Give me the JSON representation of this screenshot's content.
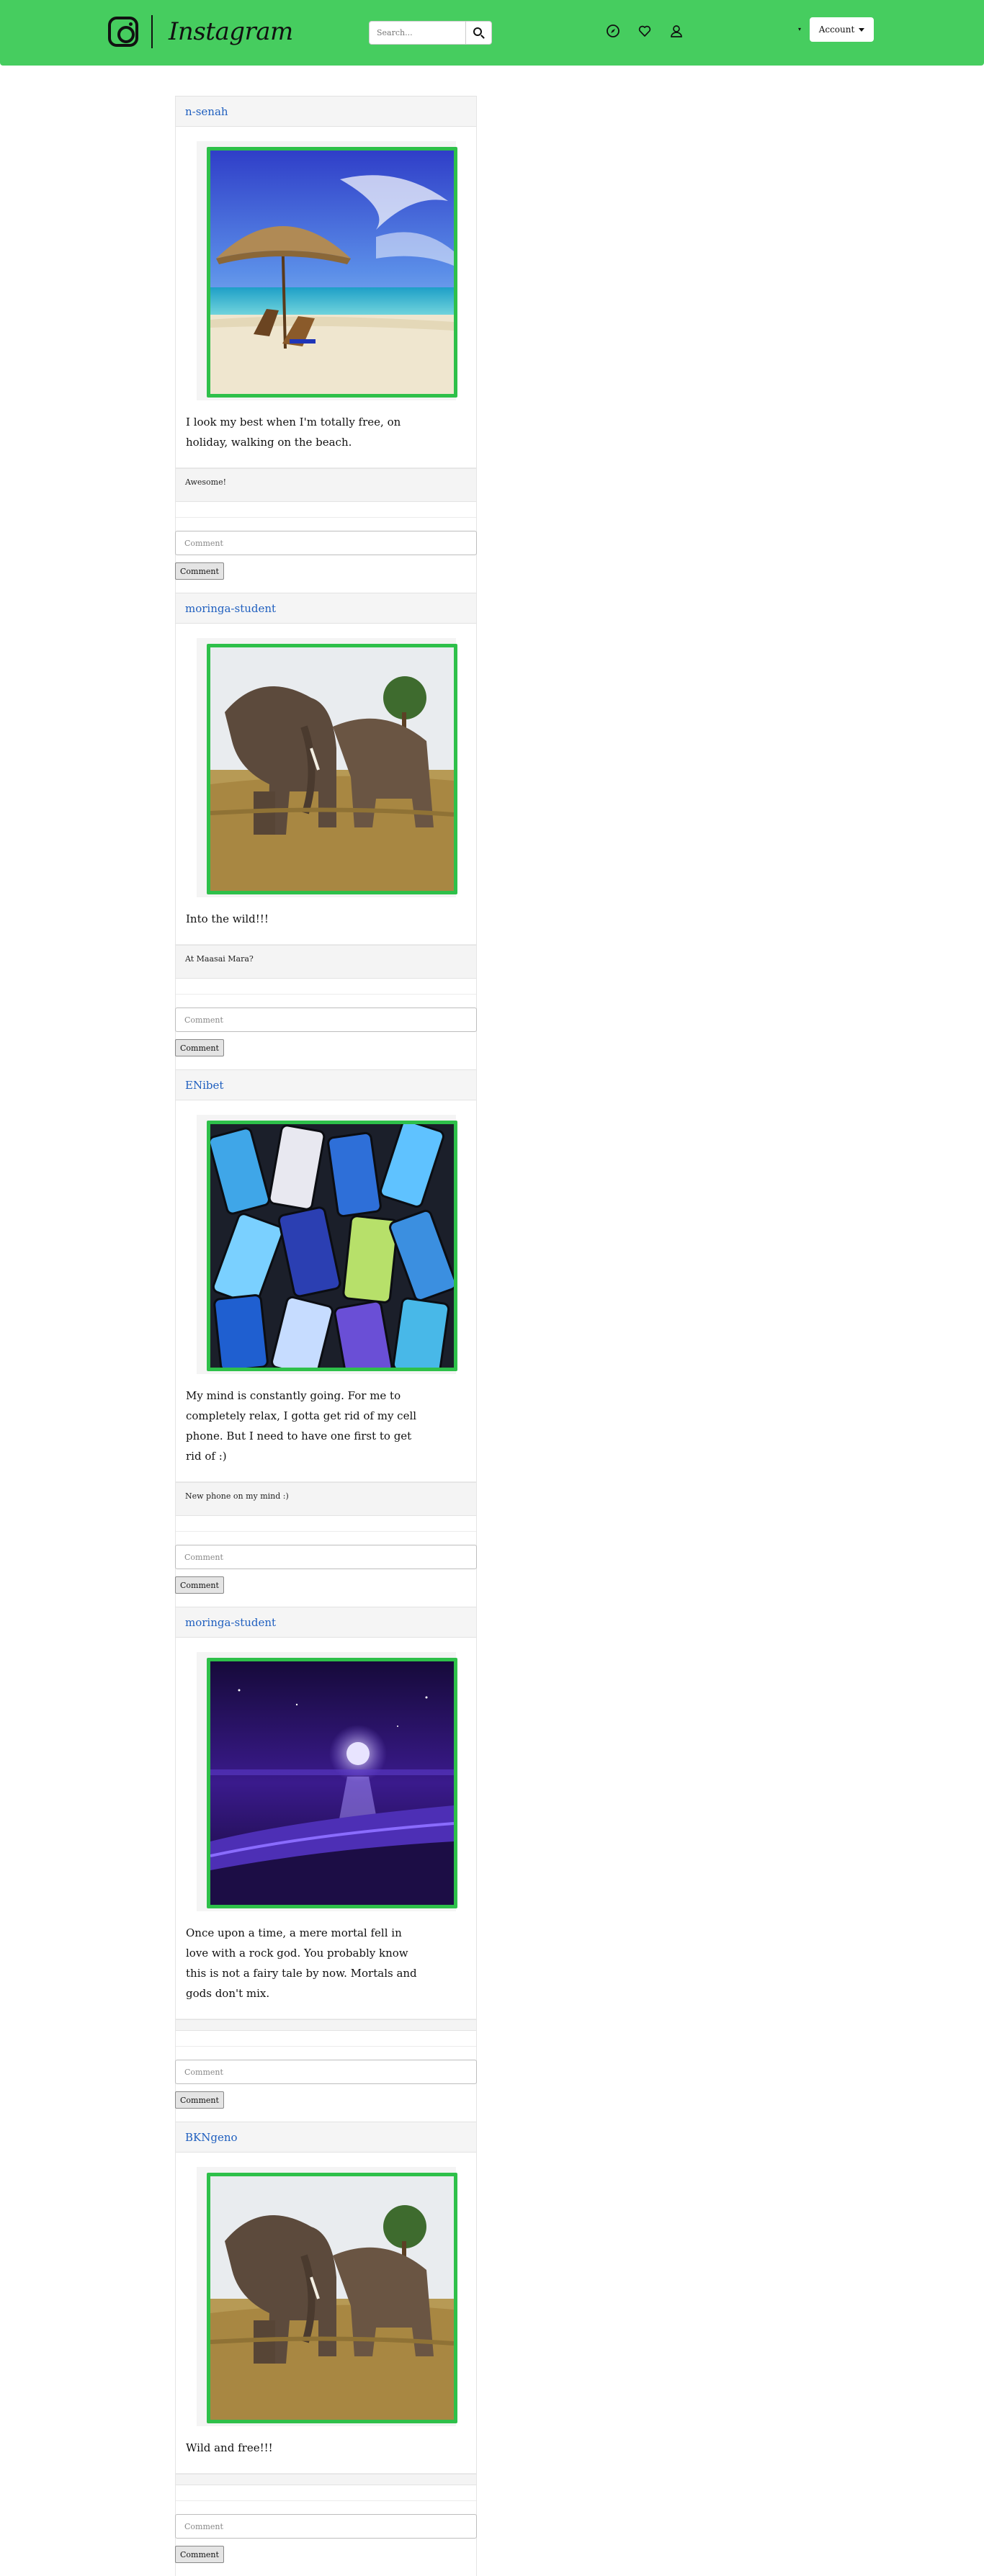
{
  "nav": {
    "brand": "Instagram",
    "search_placeholder": "Search...",
    "account_label": "Account",
    "icons": [
      "instagram-logo-icon",
      "search-icon",
      "compass-icon",
      "heart-icon",
      "user-icon",
      "caret-down-icon"
    ],
    "accent_color": "#46cd5f"
  },
  "comment_placeholder": "Comment",
  "comment_button_label": "Comment",
  "posts": [
    {
      "username": "n-senah",
      "image": "beach-umbrella-photo",
      "caption": "I look my best when I'm totally free, on holiday, walking on the beach.",
      "comments": [
        "Awesome!"
      ]
    },
    {
      "username": "moringa-student",
      "image": "elephants-photo",
      "caption": "Into the wild!!!",
      "comments": [
        "At Maasai Mara?"
      ]
    },
    {
      "username": "ENibet",
      "image": "mobile-phones-photo",
      "caption": "My mind is constantly going. For me to completely relax, I gotta get rid of my cell phone. But I need to have one first to get rid of :)",
      "comments": [
        "New phone on my mind :)"
      ]
    },
    {
      "username": "moringa-student",
      "image": "moonlit-sea-photo",
      "caption": "Once upon a time, a mere mortal fell in love with a rock god. You probably know this is not a fairy tale by now. Mortals and gods don't mix.",
      "comments": []
    },
    {
      "username": "BKNgeno",
      "image": "elephants-photo",
      "caption": "Wild and free!!!",
      "comments": []
    }
  ]
}
